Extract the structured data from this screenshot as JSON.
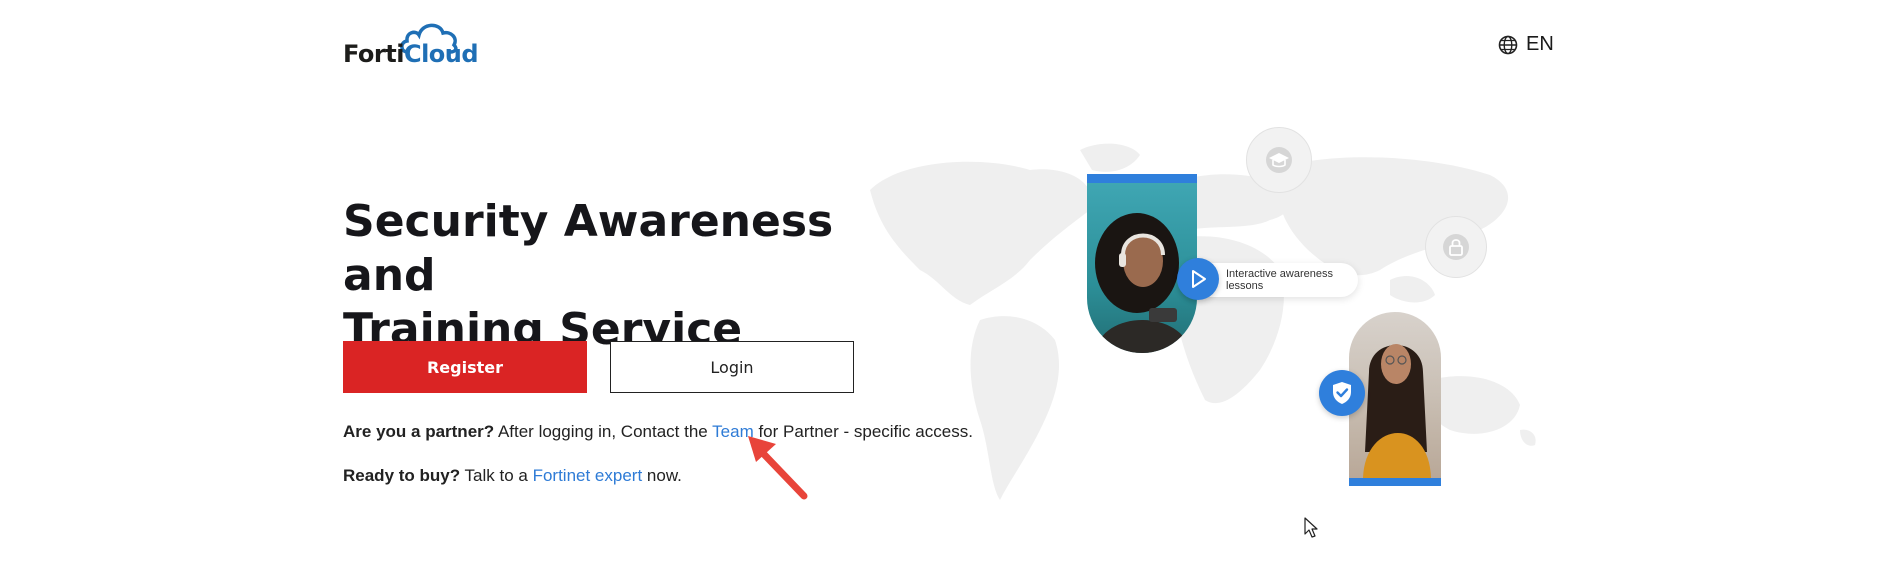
{
  "header": {
    "logo": {
      "part1": "Forti",
      "part2": "Cloud"
    },
    "language": "EN"
  },
  "hero": {
    "title_line1": "Security Awareness and",
    "title_line2": "Training Service",
    "register_label": "Register",
    "login_label": "Login"
  },
  "partner": {
    "lead": "Are you a partner?",
    "text_before": " After logging in, Contact the ",
    "link": "Team",
    "text_after": " for Partner - specific access."
  },
  "buy": {
    "lead": "Ready to buy?",
    "text_before": " Talk to a ",
    "link": "Fortinet expert",
    "text_after": " now."
  },
  "illustration": {
    "chip_text": "Interactive awareness lessons",
    "icons": [
      "graduation-cap-icon",
      "lock-icon",
      "play-icon",
      "shield-check-icon"
    ]
  },
  "colors": {
    "brand_red": "#da2424",
    "link_blue": "#2e7bd6",
    "accent_blue": "#2f7fdc"
  }
}
